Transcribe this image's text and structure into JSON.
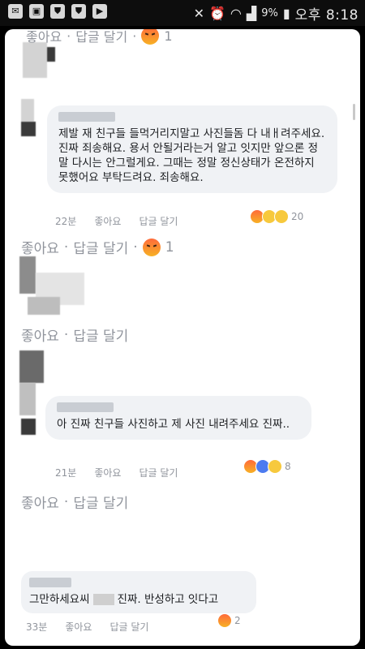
{
  "status_bar": {
    "icons": [
      "message-icon",
      "app-icon",
      "shield-icon",
      "shield-icon",
      "play-icon"
    ],
    "battery": "9%",
    "time": "오후 8:18"
  },
  "thread": {
    "top_actions": {
      "like": "좋아요",
      "reply": "답글 달기",
      "count": "1"
    },
    "comment1": {
      "text": "제발 재 친구들 들먹거리지말고 사진들돔 다 내ㅐ려주세요. 진짜 죄송해요. 용서 안될거라는거 알고 잇지만 앞으론 정말 다시는 안그럴게요. 그때는 정말 정신상태가 온전하지 못했어요 부탁드려요. 죄송해요.",
      "time": "22분",
      "like": "좋아요",
      "reply": "답글 달기",
      "reactions": "20"
    },
    "actions2": {
      "like": "좋아요",
      "reply": "답글 달기",
      "count": "1"
    },
    "actions3": {
      "like": "좋아요",
      "reply": "답글 달기"
    },
    "comment2": {
      "text": "아 진짜 친구들 사진하고 제 사진 내려주세요 진짜..",
      "time": "21분",
      "like": "좋아요",
      "reply": "답글 달기",
      "reactions": "8"
    },
    "actions4": {
      "like": "좋아요",
      "reply": "답글 달기"
    },
    "comment3": {
      "text_a": "그만하세요씨",
      "text_b": "진짜. 반성하고 잇다고",
      "time": "33분",
      "like": "좋아요",
      "reply": "답글 달기",
      "reactions": "2"
    }
  },
  "colors": {
    "angry": "#f26b3a",
    "like": "#4c7bf0",
    "meta": "#90949c",
    "bubble": "#f0f2f5"
  }
}
